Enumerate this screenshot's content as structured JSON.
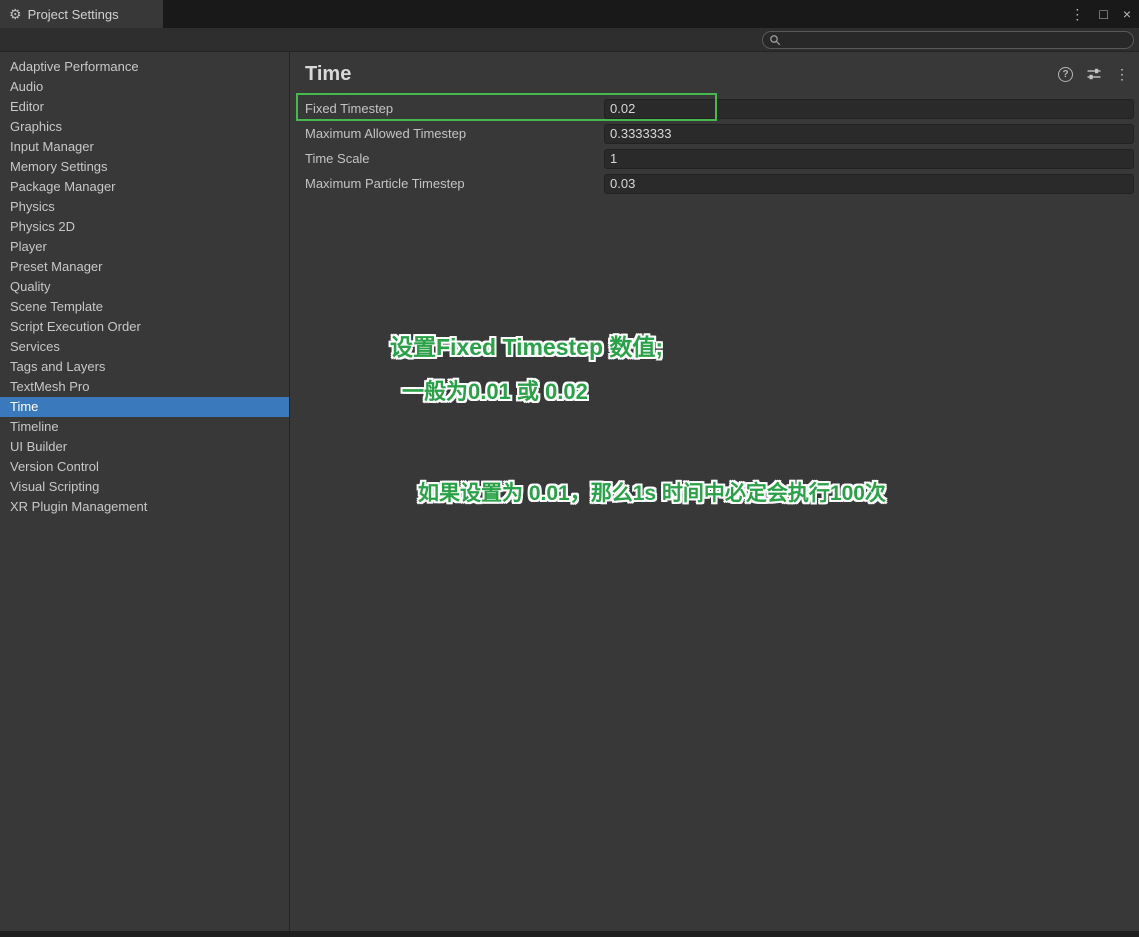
{
  "window": {
    "title": "Project Settings",
    "tab_icon": "⚙",
    "controls": {
      "menu": "⋮",
      "maximize": "□",
      "close": "×"
    }
  },
  "search": {
    "value": ""
  },
  "sidebar": {
    "selected_item": "Time",
    "items": [
      "Adaptive Performance",
      "Audio",
      "Editor",
      "Graphics",
      "Input Manager",
      "Memory Settings",
      "Package Manager",
      "Physics",
      "Physics 2D",
      "Player",
      "Preset Manager",
      "Quality",
      "Scene Template",
      "Script Execution Order",
      "Services",
      "Tags and Layers",
      "TextMesh Pro",
      "Time",
      "Timeline",
      "UI Builder",
      "Version Control",
      "Visual Scripting",
      "XR Plugin Management"
    ]
  },
  "main": {
    "title": "Time",
    "help_icon": "?",
    "more_icon": "⋮",
    "fields": [
      {
        "label": "Fixed Timestep",
        "value": "0.02",
        "highlighted": true
      },
      {
        "label": "Maximum Allowed Timestep",
        "value": "0.3333333",
        "highlighted": false
      },
      {
        "label": "Time Scale",
        "value": "1",
        "highlighted": false
      },
      {
        "label": "Maximum Particle Timestep",
        "value": "0.03",
        "highlighted": false
      }
    ],
    "annotations": [
      "设置Fixed Timestep 数值;",
      "一般为0.01 或 0.02",
      "如果设置为 0.01，那么1s 时间中必定会执行100次"
    ]
  },
  "colors": {
    "selection_blue": "#3A79BB",
    "highlight_green": "#45B94D",
    "annotation_green": "#29A147",
    "panel_bg": "#383838",
    "titlebar_bg": "#191919",
    "field_bg": "#2A2A2A"
  }
}
